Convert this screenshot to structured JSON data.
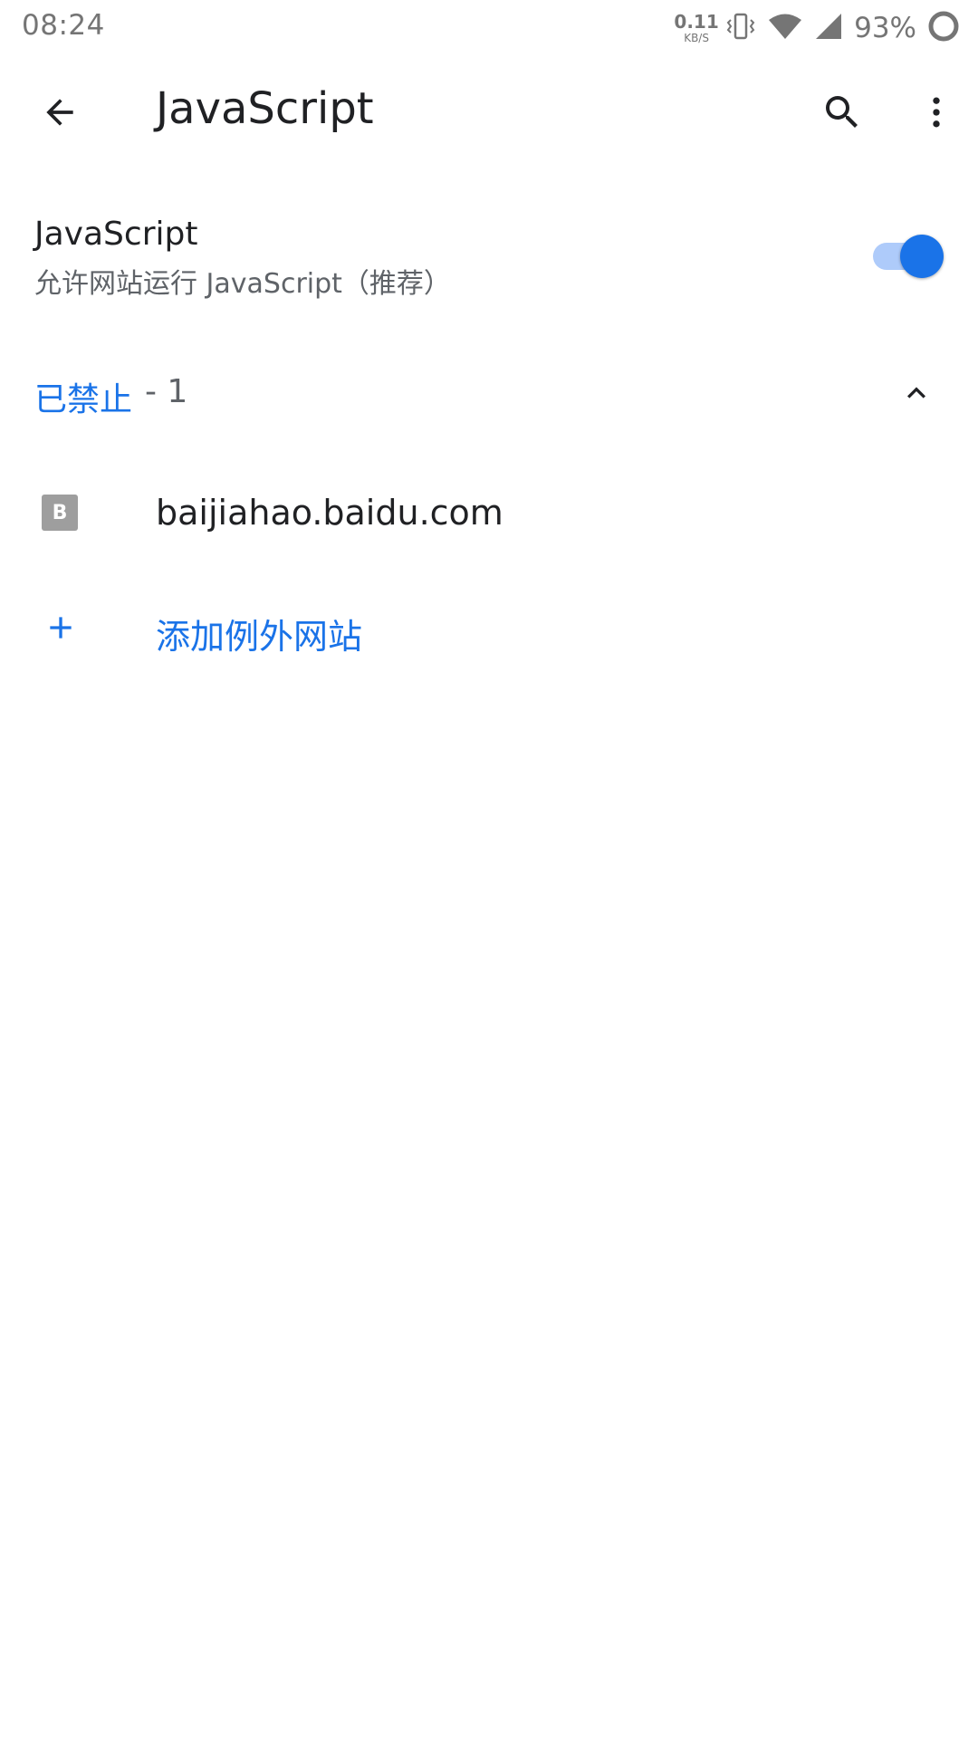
{
  "status_bar": {
    "time": "08:24",
    "net_speed_value": "0.11",
    "net_speed_unit": "KB/S",
    "battery_percent": "93%"
  },
  "app_bar": {
    "title": "JavaScript",
    "back_icon": "arrow-back-icon",
    "search_icon": "search-icon",
    "more_icon": "more-vert-icon"
  },
  "javascript_setting": {
    "title": "JavaScript",
    "subtitle": "允许网站运行 JavaScript（推荐）",
    "enabled": true
  },
  "blocked_section": {
    "label": "已禁止",
    "count": " - 1",
    "expanded": true
  },
  "sites": [
    {
      "favicon_letter": "B",
      "name": "baijiahao.baidu.com"
    }
  ],
  "add_exception": {
    "label": "添加例外网站"
  },
  "colors": {
    "accent": "#1a73e8",
    "toggle_track": "#aecbfa",
    "text_primary": "#202124",
    "text_secondary": "#5f6368",
    "favicon_bg": "#9e9e9e"
  }
}
